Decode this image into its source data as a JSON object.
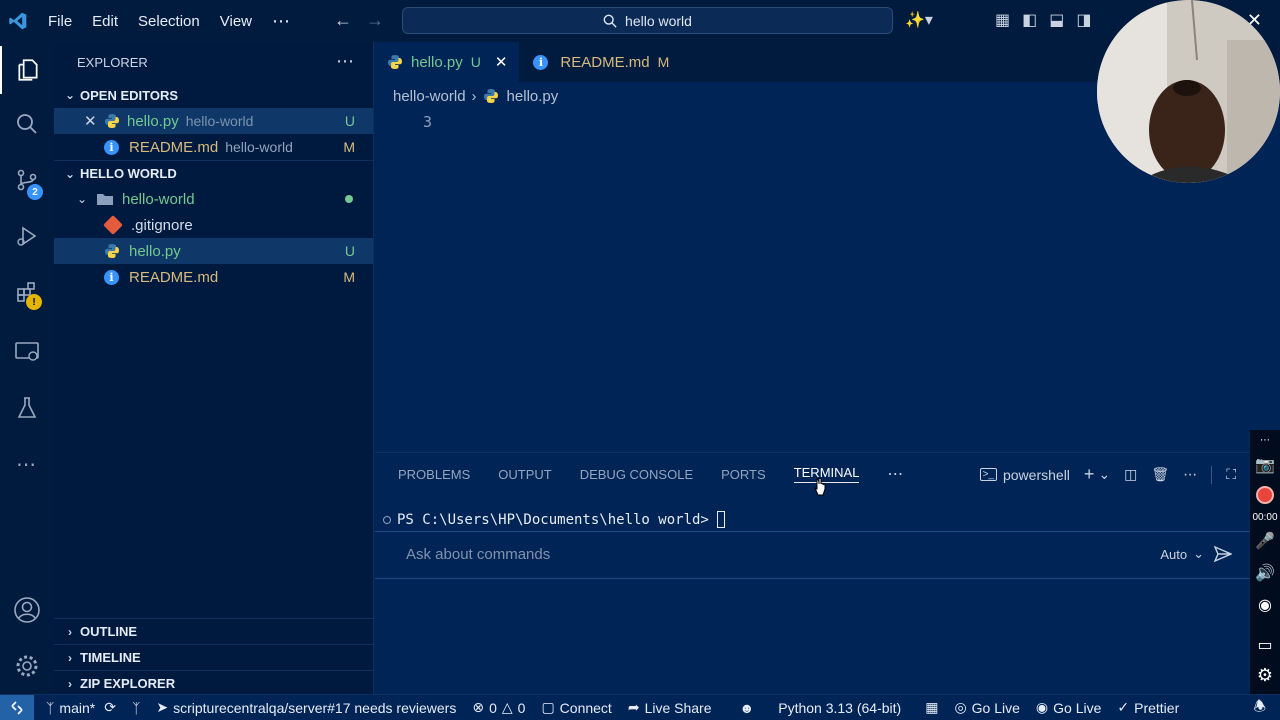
{
  "titlebar": {
    "menu": [
      "File",
      "Edit",
      "Selection",
      "View"
    ],
    "more": "⋯",
    "search_text": "hello world"
  },
  "activity": {
    "scm_badge": "2"
  },
  "sidebar": {
    "title": "EXPLORER",
    "open_editors": {
      "header": "OPEN EDITORS",
      "items": [
        {
          "name": "hello.py",
          "desc": "hello-world",
          "status": "U"
        },
        {
          "name": "README.md",
          "desc": "hello-world",
          "status": "M"
        }
      ]
    },
    "workspace": {
      "header": "HELLO WORLD",
      "folder": "hello-world",
      "files": [
        {
          "name": ".gitignore",
          "status": ""
        },
        {
          "name": "hello.py",
          "status": "U"
        },
        {
          "name": "README.md",
          "status": "M"
        }
      ]
    },
    "bottom": [
      "OUTLINE",
      "TIMELINE",
      "ZIP EXPLORER"
    ]
  },
  "editor": {
    "tabs": [
      {
        "label": "hello.py",
        "status": "U"
      },
      {
        "label": "README.md",
        "status": "M"
      }
    ],
    "breadcrumb": [
      "hello-world",
      "hello.py"
    ],
    "line_number": "3"
  },
  "panel": {
    "tabs": [
      "PROBLEMS",
      "OUTPUT",
      "DEBUG CONSOLE",
      "PORTS",
      "TERMINAL"
    ],
    "active_tab": "TERMINAL",
    "shell": "powershell",
    "prompt": "PS C:\\Users\\HP\\Documents\\hello world>",
    "ask_placeholder": "Ask about commands",
    "ask_mode": "Auto"
  },
  "recorder": {
    "time": "00:00"
  },
  "statusbar": {
    "branch": "main*",
    "pr": "scripturecentralqa/server#17 needs reviewers",
    "errors": "0",
    "warnings": "0",
    "connect": "Connect",
    "live_share": "Live Share",
    "python": "Python 3.13 (64-bit)",
    "go_live_1": "Go Live",
    "go_live_2": "Go Live",
    "prettier": "Prettier"
  },
  "colors": {
    "accent": "#2462a8",
    "untracked": "#73c991",
    "modified": "#d7ba7d",
    "background": "#012456"
  }
}
